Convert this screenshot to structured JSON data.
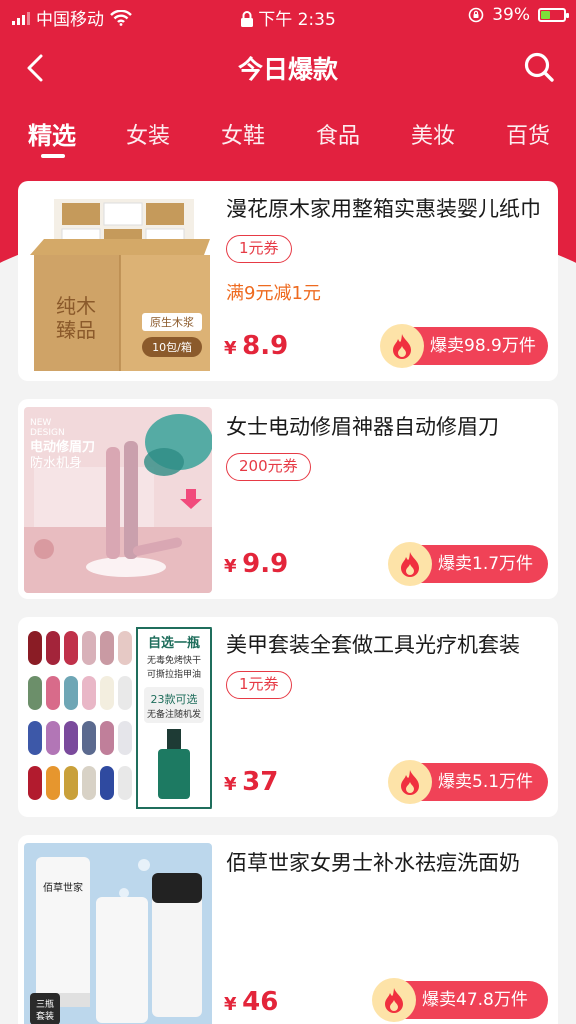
{
  "status_bar": {
    "carrier": "中国移动",
    "time": "下午 2:35",
    "battery_percent": "39%",
    "battery_level": 0.39
  },
  "navbar": {
    "title": "今日爆款",
    "back_icon": "chevron-left-icon",
    "search_icon": "search-icon"
  },
  "tabs": [
    {
      "label": "精选",
      "active": true
    },
    {
      "label": "女装",
      "active": false
    },
    {
      "label": "女鞋",
      "active": false
    },
    {
      "label": "食品",
      "active": false
    },
    {
      "label": "美妆",
      "active": false
    },
    {
      "label": "百货",
      "active": false
    }
  ],
  "products": [
    {
      "title": "漫花原木家用整箱实惠装婴儿纸巾",
      "coupon": "1元券",
      "promo": "满9元减1元",
      "currency": "¥",
      "price": "8.9",
      "sales": "爆卖98.9万件",
      "image_text": [
        "纯木",
        "臻品",
        "原生木浆",
        "10包/箱"
      ]
    },
    {
      "title": "女士电动修眉神器自动修眉刀",
      "coupon": "200元券",
      "promo": "",
      "currency": "¥",
      "price": "9.9",
      "sales": "爆卖1.7万件",
      "image_text": [
        "NEW",
        "DESIGN",
        "电动修眉刀",
        "防水机身"
      ]
    },
    {
      "title": "美甲套装全套做工具光疗机套装",
      "coupon": "1元券",
      "promo": "",
      "currency": "¥",
      "price": "37",
      "sales": "爆卖5.1万件",
      "image_text": [
        "自选一瓶",
        "无毒免烤快干",
        "可撕拉指甲油",
        "23款可选",
        "无备注随机发"
      ]
    },
    {
      "title": "佰草世家女男士补水祛痘洗面奶",
      "coupon": "",
      "promo": "",
      "currency": "¥",
      "price": "46",
      "sales": "爆卖47.8万件",
      "image_text": [
        "佰草世家",
        "三瓶",
        "套装"
      ]
    }
  ],
  "colors": {
    "brand_red": "#e2213f",
    "price_red": "#e3253a",
    "hot_badge": "#f04257",
    "promo_orange": "#ee6a1f"
  }
}
